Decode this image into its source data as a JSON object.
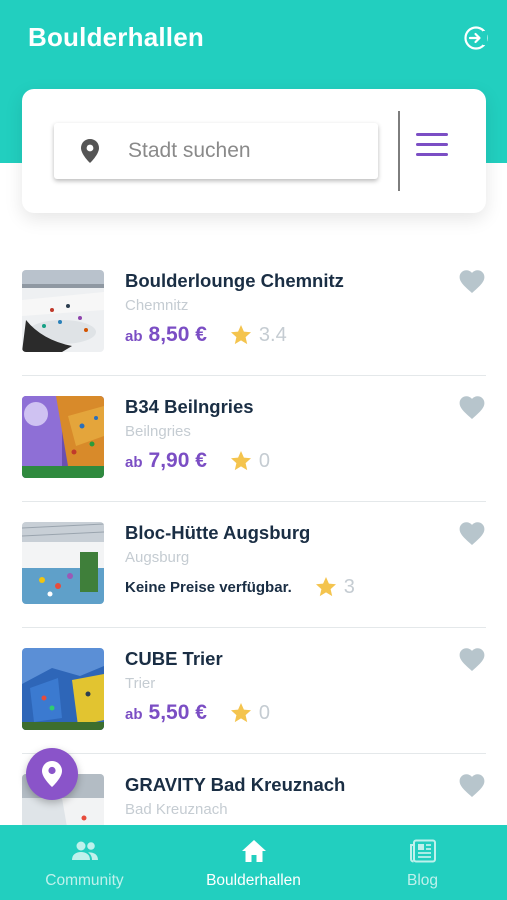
{
  "app": {
    "title": "Boulderhallen"
  },
  "search": {
    "placeholder": "Stadt suchen",
    "value": ""
  },
  "icons": {
    "login": "login-icon",
    "location": "location-pin-icon",
    "menu": "hamburger-menu-icon",
    "favorite": "heart-icon",
    "rating": "star-icon",
    "map_fab": "map-pin-icon"
  },
  "colors": {
    "primary": "#22cfbf",
    "accent": "#7b4ec4",
    "star": "#f4c44e",
    "heart": "#b7c5cc",
    "title_text": "#1a2e44",
    "muted_text": "#c5ccd2"
  },
  "gyms": [
    {
      "name": "Boulderlounge Chemnitz",
      "city": "Chemnitz",
      "price_prefix": "ab",
      "price": "8,50 €",
      "no_price_text": "",
      "rating": "3.4"
    },
    {
      "name": "B34 Beilngries",
      "city": "Beilngries",
      "price_prefix": "ab",
      "price": "7,90 €",
      "no_price_text": "",
      "rating": "0"
    },
    {
      "name": "Bloc-Hütte Augsburg",
      "city": "Augsburg",
      "price_prefix": "",
      "price": "",
      "no_price_text": "Keine Preise verfügbar.",
      "rating": "3"
    },
    {
      "name": "CUBE Trier",
      "city": "Trier",
      "price_prefix": "ab",
      "price": "5,50 €",
      "no_price_text": "",
      "rating": "0"
    },
    {
      "name": "GRAVITY Bad Kreuznach",
      "city": "Bad Kreuznach",
      "price_prefix": "",
      "price": "",
      "no_price_text": "",
      "rating": ""
    }
  ],
  "nav": {
    "items": [
      {
        "label": "Community",
        "icon": "community-icon",
        "active": false
      },
      {
        "label": "Boulderhallen",
        "icon": "home-icon",
        "active": true
      },
      {
        "label": "Blog",
        "icon": "newspaper-icon",
        "active": false
      }
    ]
  }
}
